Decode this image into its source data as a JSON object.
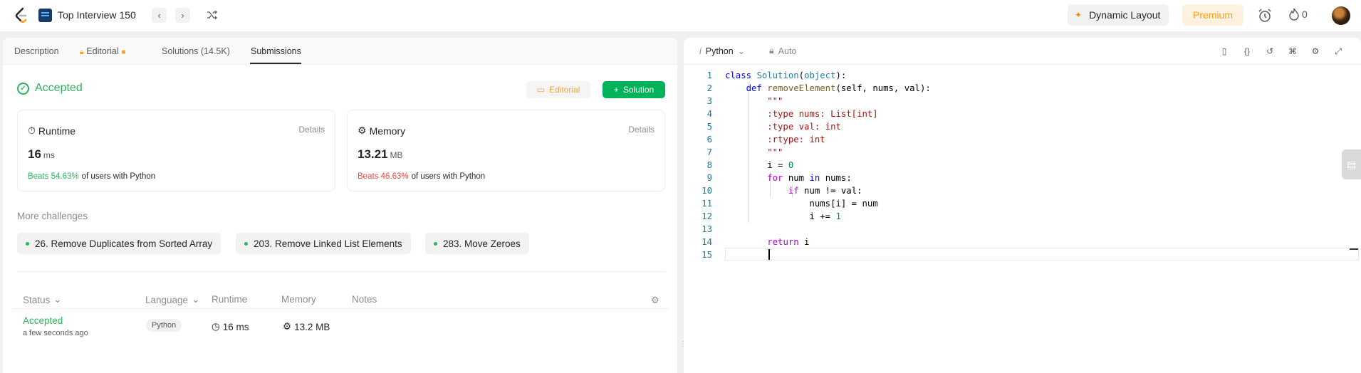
{
  "topnav": {
    "list_title": "Top Interview 150",
    "dynamic_layout_label": "Dynamic Layout",
    "premium_label": "Premium",
    "streak_count": "0"
  },
  "tabs": [
    {
      "label": "Description"
    },
    {
      "label": "Editorial"
    },
    {
      "label": "Solutions (14.5K)"
    },
    {
      "label": "Submissions"
    }
  ],
  "result": {
    "status": "Accepted",
    "editorial_button": "Editorial",
    "solution_button": "Solution"
  },
  "runtime_card": {
    "title": "Runtime",
    "details": "Details",
    "value": "16",
    "unit": "ms",
    "beats": "Beats 54.63%",
    "suffix": "of users with Python"
  },
  "memory_card": {
    "title": "Memory",
    "details": "Details",
    "value": "13.21",
    "unit": "MB",
    "beats": "Beats 46.63%",
    "suffix": "of users with Python"
  },
  "more_challenges": {
    "label": "More challenges",
    "items": [
      "26. Remove Duplicates from Sorted Array",
      "203. Remove Linked List Elements",
      "283. Move Zeroes"
    ]
  },
  "submissions_table": {
    "headers": [
      "Status",
      "Language",
      "Runtime",
      "Memory",
      "Notes"
    ],
    "rows": [
      {
        "status": "Accepted",
        "time": "a few seconds ago",
        "language": "Python",
        "runtime": "16 ms",
        "memory": "13.2 MB"
      }
    ]
  },
  "editor": {
    "language": "Python",
    "mode": "Auto",
    "line_numbers": [
      "1",
      "2",
      "3",
      "4",
      "5",
      "6",
      "7",
      "8",
      "9",
      "10",
      "11",
      "12",
      "13",
      "14",
      "15"
    ]
  },
  "colors": {
    "accepted": "#2db55d",
    "beats_good": "#2db55d",
    "beats_bad": "#ef4743",
    "premium": "#ffa116",
    "solution_button": "#00b35b"
  }
}
